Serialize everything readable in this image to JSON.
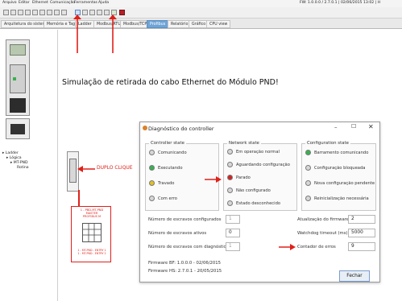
{
  "menubar": {
    "items": [
      "Arquivo",
      "Editar",
      "Ethernet",
      "Comunicação",
      "Ferramentas",
      "Ajuda"
    ],
    "status": "FW: 1.0.0.0 / 2.7.0.1 | 02/06/2015 13:02 | H"
  },
  "tabs": [
    "Arquitetura do sistema",
    "Memória e Tags",
    "Ladder",
    "Modbus/RTU",
    "Modbus/TCP",
    "Profibus",
    "Relatório",
    "Gráfico",
    "CPU view"
  ],
  "active_tab_index": 5,
  "tree": {
    "root": "Ladder",
    "child": "Lógica",
    "sub": "MT-PND",
    "leaf": "Rotina"
  },
  "annotation": {
    "main": "Simulação de retirada do cabo Ethernet do Módulo PND!",
    "double_click": "DUPLO CLIQUE"
  },
  "module_card": {
    "line1": "1 - PBD-MT-PND",
    "line2": "MASTER",
    "line3": "PROFIBUS M",
    "line4": "1 - MT-PND - ENTRY 1",
    "line5": "1 - MT-PND - ENTRY 2"
  },
  "dialog": {
    "title": "Diagnóstico do controller",
    "controller_state": {
      "label": "Controller state",
      "items": [
        {
          "text": "Comunicando",
          "color": "#d7d7d7"
        },
        {
          "text": "Executando",
          "color": "#37b24d"
        },
        {
          "text": "Travado",
          "color": "#e0c021"
        },
        {
          "text": "Com erro",
          "color": "#d7d7d7"
        }
      ]
    },
    "network_state": {
      "label": "Network state",
      "items": [
        {
          "text": "Em operação normal",
          "color": "#d7d7d7"
        },
        {
          "text": "Aguardando configuração",
          "color": "#d7d7d7"
        },
        {
          "text": "Parado",
          "color": "#d32222"
        },
        {
          "text": "Não configurado",
          "color": "#d7d7d7"
        },
        {
          "text": "Estado desconhecido",
          "color": "#d7d7d7"
        }
      ]
    },
    "configuration_state": {
      "label": "Configuration state",
      "items": [
        {
          "text": "Barramento comunicando",
          "color": "#37b24d"
        },
        {
          "text": "Configuração bloqueada",
          "color": "#d7d7d7"
        },
        {
          "text": "Nova configuração pendente",
          "color": "#d7d7d7"
        },
        {
          "text": "Reinicialização necessária",
          "color": "#d7d7d7"
        }
      ]
    },
    "fields_left": [
      {
        "label": "Número de escravos configurados",
        "value": "1"
      },
      {
        "label": "Número de escravos ativos",
        "value": "0"
      },
      {
        "label": "Número de escravos com diagnóstico",
        "value": "1"
      }
    ],
    "fields_right": [
      {
        "label": "Atualização do firmware",
        "value": "2"
      },
      {
        "label": "Watchdog timeout   (ms)",
        "value": "5000"
      },
      {
        "label": "Contador de erros",
        "value": "9"
      }
    ],
    "firmware_bf": "Firmware BF: 1.0.0.0 - 02/06/2015",
    "firmware_hs": "Firmware HS: 2.7.0.1 - 20/05/2015",
    "close_label": "Fechar"
  },
  "colors": {
    "accent_red": "#e0201a",
    "tab_active": "#6fa3d6"
  }
}
